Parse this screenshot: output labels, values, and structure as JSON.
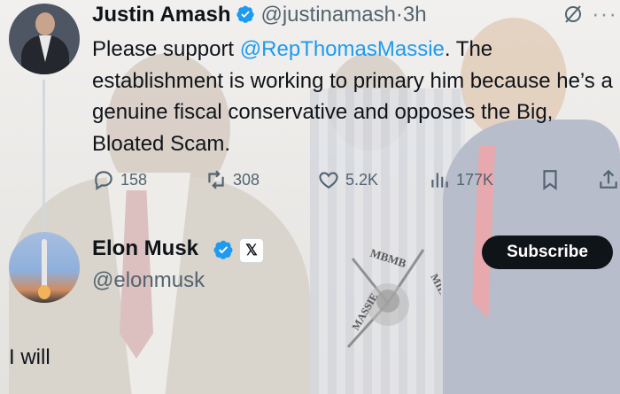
{
  "tweet": {
    "author_name": "Justin Amash",
    "author_handle": "@justinamash",
    "separator": "·",
    "time": "3h",
    "text_before": "Please support ",
    "mention": "@RepThomasMassie",
    "text_after": ". The establishment is working to primary him because he’s a genuine fiscal conservative and opposes the Big, Bloated Scam.",
    "stats": {
      "replies": "158",
      "reposts": "308",
      "likes": "5.2K",
      "views": "177K"
    }
  },
  "reply": {
    "author_name": "Elon Musk",
    "author_handle": "@elonmusk",
    "badge": "𝕏",
    "subscribe_label": "Subscribe",
    "text": "I will"
  },
  "watermark": {
    "top": "MBMB",
    "left": "MASSIE",
    "right": "MILITIA"
  },
  "colors": {
    "accent": "#1d9bf0",
    "text": "#0f1419",
    "muted": "#536471",
    "button_bg": "#0f1419"
  },
  "icons": [
    "reply-icon",
    "repost-icon",
    "like-icon",
    "views-icon",
    "bookmark-icon",
    "share-icon",
    "verified-icon",
    "grok-icon",
    "more-icon"
  ]
}
